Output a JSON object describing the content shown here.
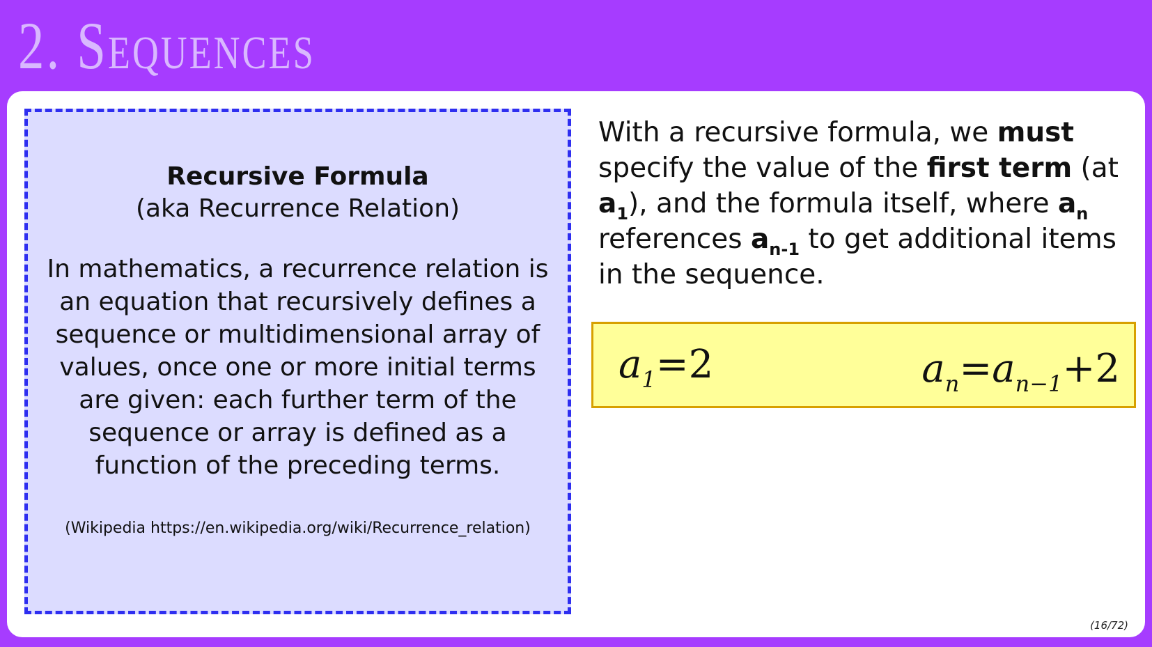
{
  "title": "2. Sequences",
  "definition": {
    "heading": "Recursive Formula",
    "aka": "(aka Recurrence Relation)",
    "body": "In mathematics, a recurrence relation is an equation that recursively defines a sequence or multidimensional array of values, once one or more initial terms are given: each further term of the sequence or array is defined as a function of the preceding terms.",
    "source": "(Wikipedia https://en.wikipedia.org/wiki/Recurrence_relation)"
  },
  "explanation": {
    "part1": "With a recursive formula, we ",
    "must": "must",
    "part2": " specify the value of the ",
    "first_term": "first term",
    "part3": " (at ",
    "a1_base": "a",
    "a1_sub": "1",
    "part4": "), and the formula itself, where ",
    "an_base": "a",
    "an_sub": "n",
    "part5": " references ",
    "an1_base": "a",
    "an1_sub": "n-1",
    "part6": " to get additional items in the sequence."
  },
  "formula": {
    "left_var": "a",
    "left_sub": "1",
    "left_eq": "=2",
    "right_var": "a",
    "right_sub": "n",
    "right_eq": "=",
    "right_var2": "a",
    "right_sub2": "n−1",
    "right_tail": "+2"
  },
  "page_number": "(16/72)",
  "colors": {
    "background": "#a63cff",
    "title": "#d9b8ff",
    "definition_bg": "#dcdcff",
    "definition_border": "#2e2ef0",
    "formula_bg": "#ffff99",
    "formula_border": "#d7a000"
  }
}
